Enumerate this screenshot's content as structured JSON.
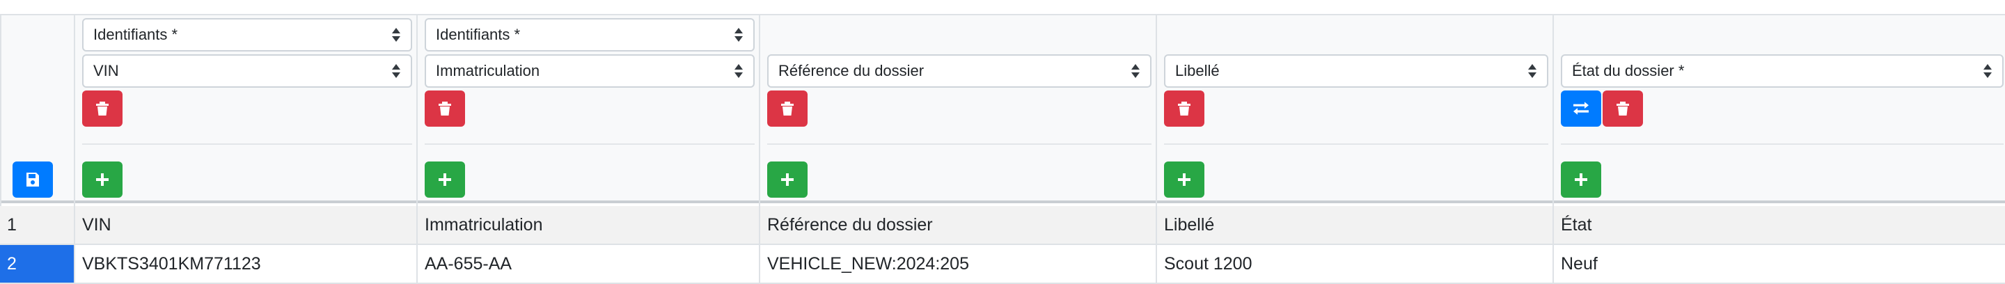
{
  "columns": [
    {
      "selects": [
        "Identifiants *",
        "VIN"
      ],
      "has_swap": false
    },
    {
      "selects": [
        "Identifiants *",
        "Immatriculation"
      ],
      "has_swap": false
    },
    {
      "selects": [
        "Référence du dossier"
      ],
      "has_swap": false
    },
    {
      "selects": [
        "Libellé"
      ],
      "has_swap": false
    },
    {
      "selects": [
        "État du dossier *"
      ],
      "has_swap": true
    }
  ],
  "rows": [
    {
      "num": "1",
      "cells": [
        "VIN",
        "Immatriculation",
        "Référence du dossier",
        "Libellé",
        "État"
      ]
    },
    {
      "num": "2",
      "cells": [
        "VBKTS3401KM771123",
        "AA-655-AA",
        "VEHICLE_NEW:2024:205",
        "Scout 1200",
        "Neuf"
      ]
    }
  ],
  "icons": {
    "save": "floppy-disk-icon",
    "delete": "trash-icon",
    "add": "plus-icon",
    "swap": "swap-arrows-icon"
  },
  "colors": {
    "danger": "#dc3545",
    "success": "#28a745",
    "primary": "#007bff",
    "selected_cell": "#1e6fe8"
  }
}
